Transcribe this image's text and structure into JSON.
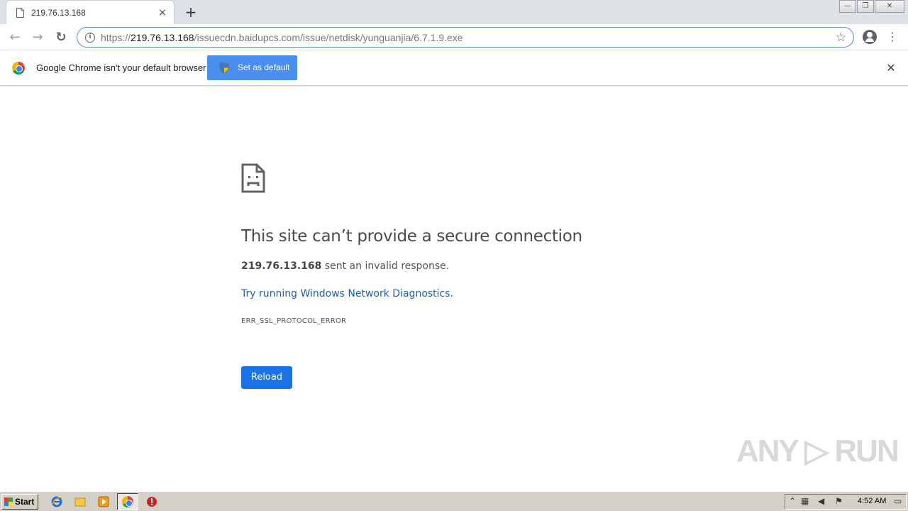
{
  "tab": {
    "title": "219.76.13.168",
    "close": "×"
  },
  "newtab": "+",
  "window": {
    "minimize": "—",
    "restore": "❐",
    "close": "✕"
  },
  "toolbar": {
    "back": "←",
    "forward": "→",
    "reload": "↻",
    "info": "i",
    "url_scheme": "https://",
    "url_host": "219.76.13.168",
    "url_path": "/issuecdn.baidupcs.com/issue/netdisk/yunguanjia/6.7.1.9.exe",
    "star": "☆",
    "menu": "⋮"
  },
  "infobar": {
    "message": "Google Chrome isn't your default browser",
    "button_label": "Set as default",
    "close": "✕"
  },
  "error": {
    "title": "This site can’t provide a secure connection",
    "host": "219.76.13.168",
    "desc_suffix": " sent an invalid response.",
    "diagnostics_link": "Try running Windows Network Diagnostics.",
    "code": "ERR_SSL_PROTOCOL_ERROR",
    "reload_label": "Reload"
  },
  "watermark": "ANY ▷ RUN",
  "taskbar": {
    "start_label": "Start",
    "clock": "4:52 AM"
  },
  "colors": {
    "accent": "#1a73e8",
    "infobar_button": "#4a8ef0",
    "link": "#1d5fb3"
  }
}
